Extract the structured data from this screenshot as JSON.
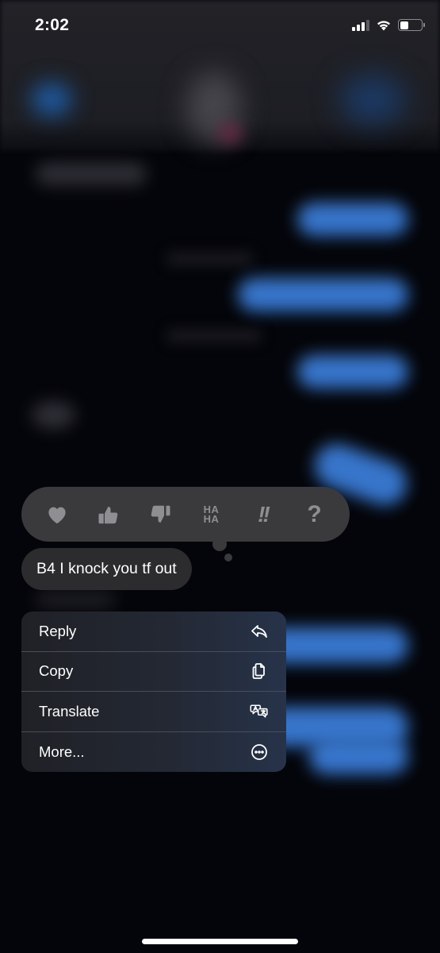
{
  "status_bar": {
    "time": "2:02",
    "signal_bars_active": 3,
    "signal_bars_total": 4,
    "wifi": true,
    "battery_percent": 40
  },
  "tapback": {
    "reactions": [
      {
        "name": "heart",
        "label": ""
      },
      {
        "name": "thumbs-up",
        "label": ""
      },
      {
        "name": "thumbs-down",
        "label": ""
      },
      {
        "name": "haha",
        "label_top": "HA",
        "label_bottom": "HA"
      },
      {
        "name": "exclamation",
        "label": "!!"
      },
      {
        "name": "question",
        "label": "?"
      }
    ]
  },
  "message": {
    "text": "B4 I knock you tf out"
  },
  "context_menu": {
    "items": [
      {
        "label": "Reply",
        "icon": "reply-icon"
      },
      {
        "label": "Copy",
        "icon": "copy-icon"
      },
      {
        "label": "Translate",
        "icon": "translate-icon"
      },
      {
        "label": "More...",
        "icon": "more-icon"
      }
    ]
  },
  "colors": {
    "accent_blue": "#3a7bd5",
    "tapback_bg": "#3a3a3c",
    "bubble_bg": "#2c2c2e",
    "reaction_gray": "#8e8e93"
  }
}
